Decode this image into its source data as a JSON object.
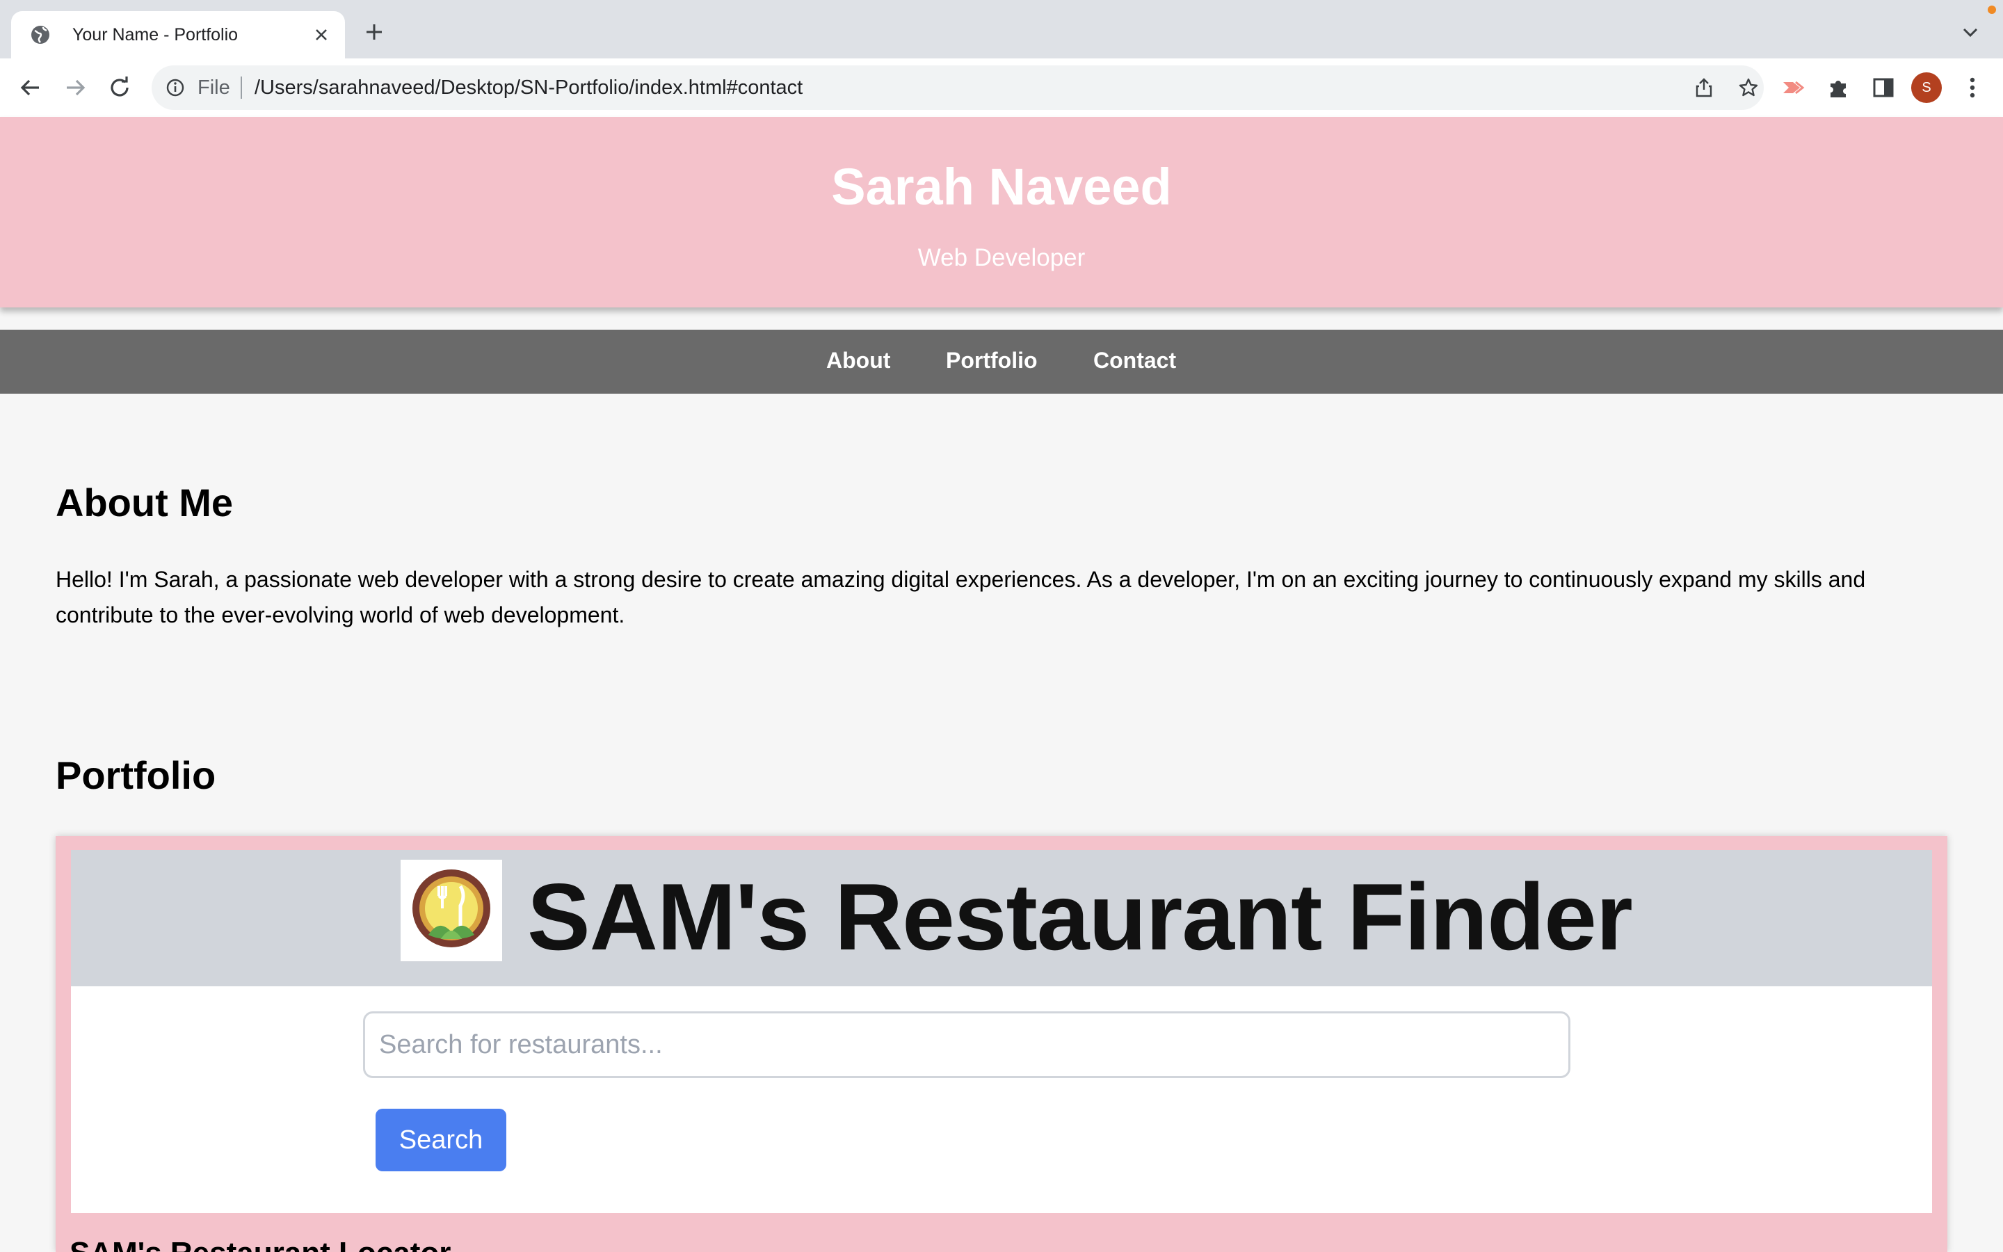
{
  "browser": {
    "tab_title": "Your Name - Portfolio",
    "address_scheme": "File",
    "address_url": "/Users/sarahnaveed/Desktop/SN-Portfolio/index.html#contact",
    "profile_initial": "S",
    "icons": [
      "globe-icon",
      "close-icon",
      "plus-icon",
      "chevron-down-icon",
      "back-icon",
      "forward-icon",
      "reload-icon",
      "info-icon",
      "share-icon",
      "star-icon",
      "extension-cast-icon",
      "puzzle-icon",
      "side-panel-icon",
      "kebab-menu-icon"
    ]
  },
  "header": {
    "name": "Sarah Naveed",
    "role": "Web Developer"
  },
  "nav": {
    "items": [
      {
        "label": "About"
      },
      {
        "label": "Portfolio"
      },
      {
        "label": "Contact"
      }
    ]
  },
  "about": {
    "heading": "About Me",
    "text": "Hello! I'm Sarah, a passionate web developer with a strong desire to create amazing digital experiences. As a developer, I'm on an exciting journey to continuously expand my skills and contribute to the ever-evolving world of web development."
  },
  "portfolio": {
    "heading": "Portfolio",
    "project": {
      "title": "SAM's Restaurant Finder",
      "search_placeholder": "Search for restaurants...",
      "search_button": "Search",
      "next_heading": "SAM's Restaurant Locator"
    }
  },
  "colors": {
    "header_bg": "#f4c2cb",
    "nav_bg": "#6a6a6a",
    "page_bg": "#f6f6f6",
    "button_blue": "#4a7ef0",
    "avatar": "#b3401f"
  }
}
